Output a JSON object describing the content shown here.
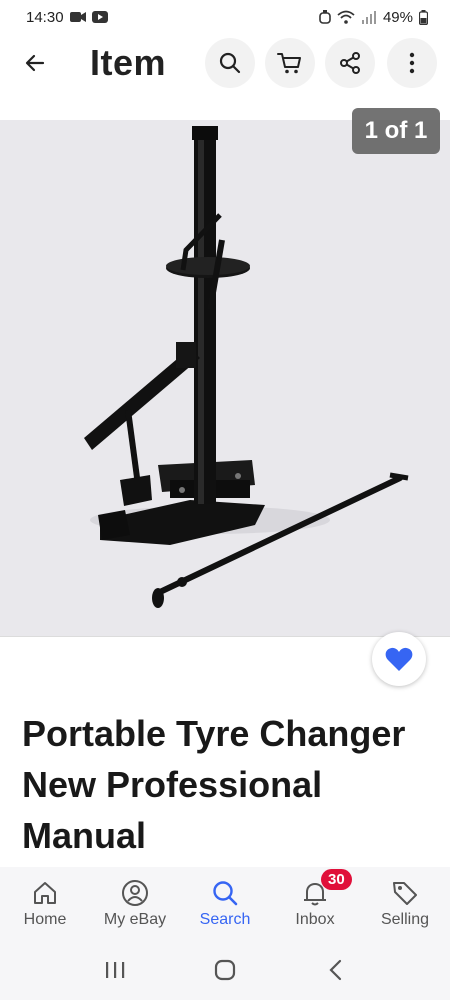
{
  "status_bar": {
    "time": "14:30",
    "battery": "49%"
  },
  "app_bar": {
    "title": "Item",
    "icons": [
      "back-arrow-icon",
      "search-icon",
      "cart-icon",
      "share-icon",
      "more-vert-icon"
    ]
  },
  "gallery": {
    "counter": "1 of 1"
  },
  "item": {
    "title": "Portable Tyre Changer New Professional Manual"
  },
  "bottom_nav": {
    "items": [
      {
        "label": "Home",
        "icon": "home-icon"
      },
      {
        "label": "My eBay",
        "icon": "account-icon"
      },
      {
        "label": "Search",
        "icon": "search-icon"
      },
      {
        "label": "Inbox",
        "icon": "bell-icon",
        "badge": "30"
      },
      {
        "label": "Selling",
        "icon": "tag-icon"
      }
    ],
    "active": "Search"
  },
  "colors": {
    "accent": "#3665f3",
    "badge": "#e0103a"
  }
}
